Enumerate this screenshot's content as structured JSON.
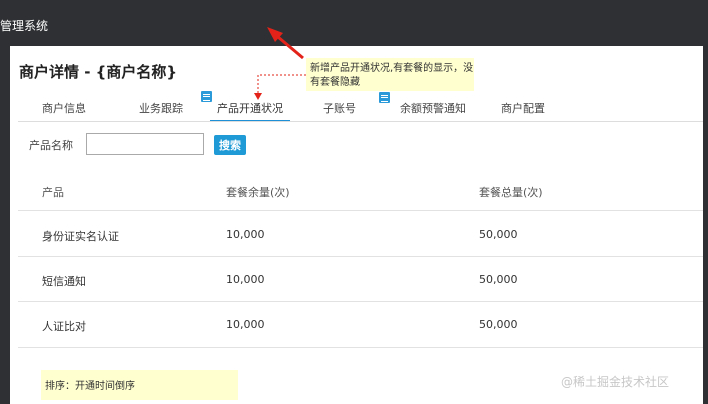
{
  "app": {
    "title": "管理系统"
  },
  "page": {
    "title": "商户详情 - {商户名称}"
  },
  "annotation": {
    "note": "新增产品开通状况,有套餐的显示，没有套餐隐藏",
    "sort_note": "排序：开通时间倒序"
  },
  "tabs": [
    {
      "label": "商户信息"
    },
    {
      "label": "业务跟踪"
    },
    {
      "label": "产品开通状况"
    },
    {
      "label": "子账号"
    },
    {
      "label": "余额预警通知"
    },
    {
      "label": "商户配置"
    }
  ],
  "search": {
    "label": "产品名称",
    "value": "",
    "placeholder": "",
    "button": "搜索"
  },
  "table": {
    "headers": [
      "产品",
      "套餐余量(次)",
      "套餐总量(次)"
    ],
    "rows": [
      [
        "身份证实名认证",
        "10,000",
        "50,000"
      ],
      [
        "短信通知",
        "10,000",
        "50,000"
      ],
      [
        "人证比对",
        "10,000",
        "50,000"
      ]
    ]
  },
  "watermark": "@稀土掘金技术社区",
  "icons": {
    "tab_note": "document-icon",
    "arrow": "red-arrow-icon"
  },
  "colors": {
    "accent": "#1f9ad6",
    "note_bg": "#ffffd0",
    "arrow": "#e3231a",
    "topbar": "#2f3033"
  }
}
